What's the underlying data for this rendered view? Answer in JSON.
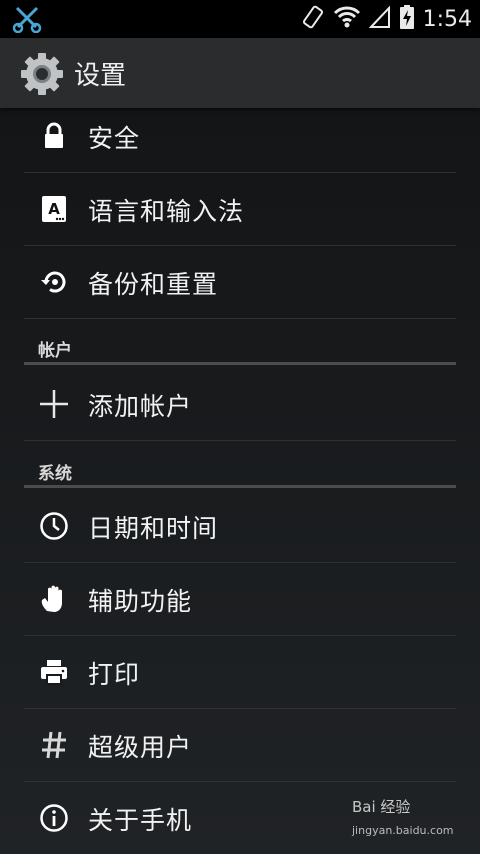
{
  "status_bar": {
    "time": "1:54"
  },
  "action_bar": {
    "title": "设置"
  },
  "items_top": [
    {
      "label": "安全",
      "icon": "lock-icon"
    },
    {
      "label": "语言和输入法",
      "icon": "keyboard-a-icon"
    },
    {
      "label": "备份和重置",
      "icon": "backup-restore-icon"
    }
  ],
  "sections": {
    "accounts": "帐户",
    "system": "系统"
  },
  "accounts_items": [
    {
      "label": "添加帐户",
      "icon": "plus-icon"
    }
  ],
  "system_items": [
    {
      "label": "日期和时间",
      "icon": "clock-icon"
    },
    {
      "label": "辅助功能",
      "icon": "hand-icon"
    },
    {
      "label": "打印",
      "icon": "printer-icon"
    },
    {
      "label": "超级用户",
      "icon": "hash-icon"
    },
    {
      "label": "关于手机",
      "icon": "info-icon"
    }
  ],
  "watermark": {
    "brand": "Bai 经验",
    "url": "jingyan.baidu.com"
  }
}
